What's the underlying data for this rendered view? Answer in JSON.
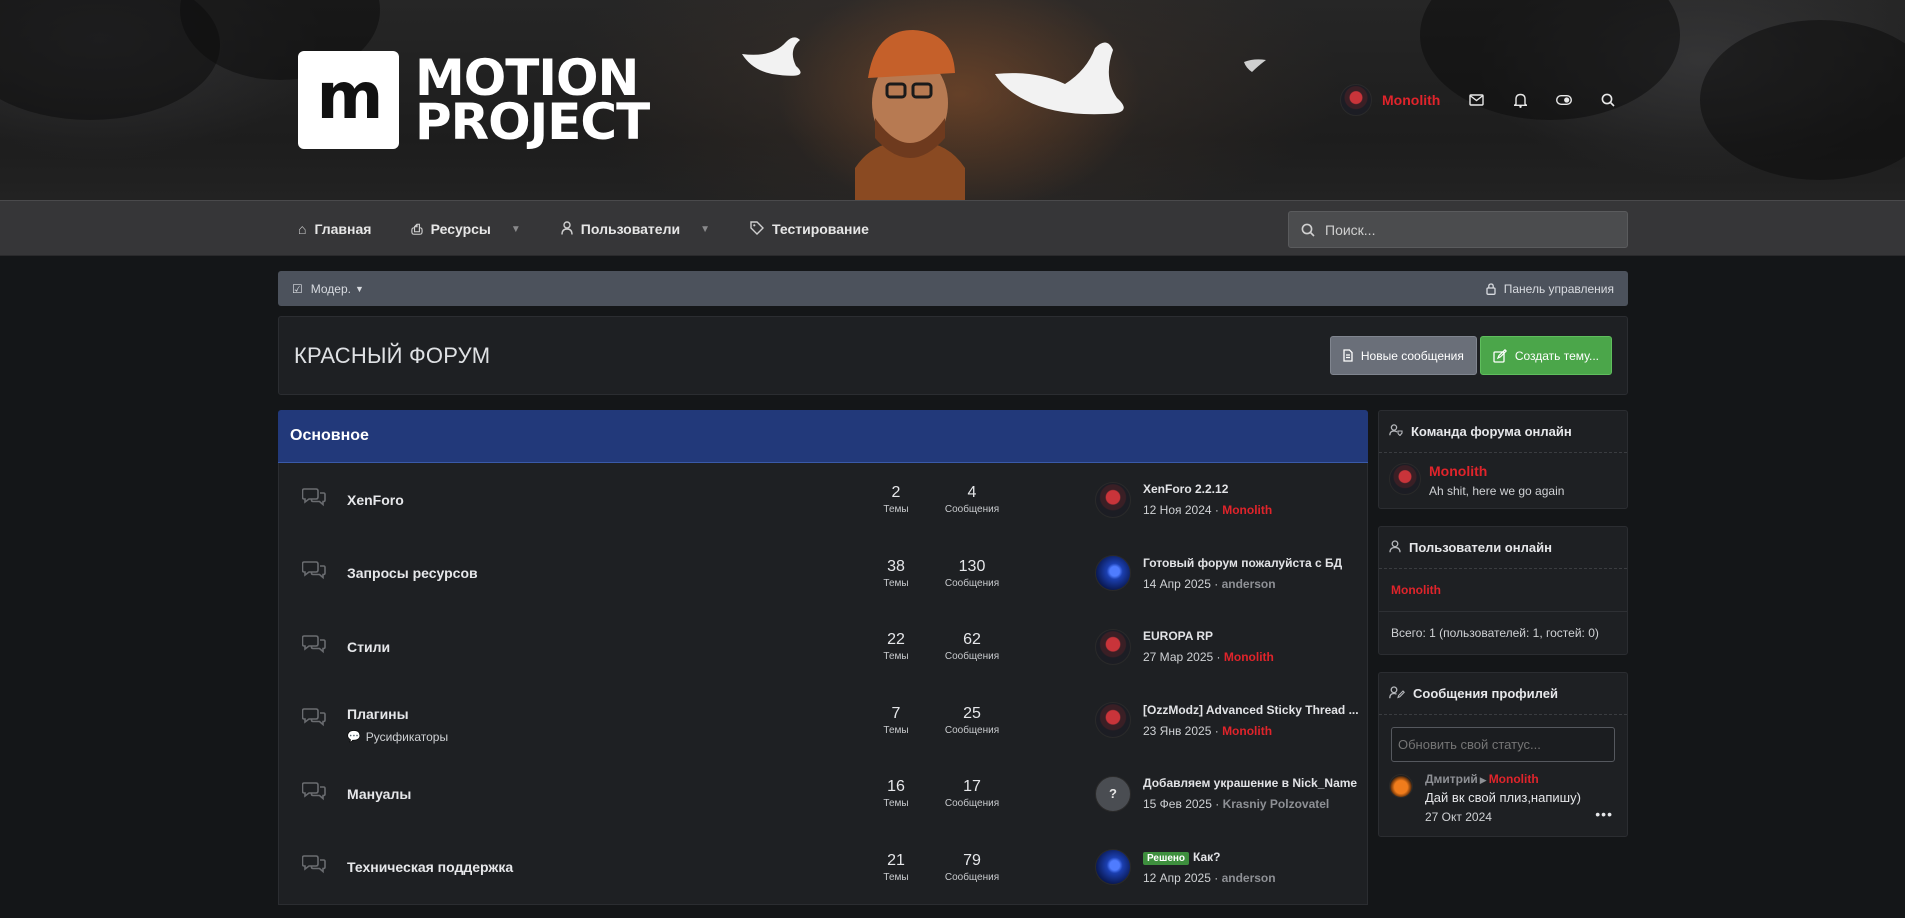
{
  "header": {
    "logo_mark": "m",
    "logo_line1": "MOTION",
    "logo_line2": "PROJECT",
    "user_name": "Monolith",
    "icons": [
      "mail-icon",
      "bell-icon",
      "toggle-icon",
      "search-icon"
    ]
  },
  "nav": {
    "items": [
      {
        "label": "Главная",
        "icon": "home-icon"
      },
      {
        "label": "Ресурсы",
        "icon": "box-icon"
      },
      {
        "label": "Пользователи",
        "icon": "user-icon"
      },
      {
        "label": "Тестирование",
        "icon": "tag-icon"
      }
    ],
    "search_placeholder": "Поиск..."
  },
  "modbar": {
    "moder_label": "Модер.",
    "panel_label": "Панель управления"
  },
  "page": {
    "title": "КРАСНЫЙ ФОРУМ",
    "btn_new_posts": "Новые сообщения",
    "btn_create_thread": "Создать тему..."
  },
  "category": {
    "title": "Основное",
    "stat_threads_label": "Темы",
    "stat_posts_label": "Сообщения",
    "forums": [
      {
        "title": "XenForo",
        "sub": "",
        "threads": "2",
        "posts": "4",
        "last_title": "XenForo 2.2.12",
        "last_date": "12 Ноя 2024",
        "last_user": "Monolith"
      },
      {
        "title": "Запросы ресурсов",
        "sub": "",
        "threads": "38",
        "posts": "130",
        "last_title": "Готовый форум пожалуйста с БД",
        "last_date": "14 Апр 2025",
        "last_user": "anderson"
      },
      {
        "title": "Стили",
        "sub": "",
        "threads": "22",
        "posts": "62",
        "last_title": "EUROPA RP",
        "last_date": "27 Мар 2025",
        "last_user": "Monolith"
      },
      {
        "title": "Плагины",
        "sub": "Русификаторы",
        "threads": "7",
        "posts": "25",
        "last_title": "[OzzModz] Advanced Sticky Thread ...",
        "last_date": "23 Янв 2025",
        "last_user": "Monolith"
      },
      {
        "title": "Мануалы",
        "sub": "",
        "threads": "16",
        "posts": "17",
        "last_title": "Добавляем украшение в Nick_Name",
        "last_date": "15 Фев 2025",
        "last_user": "Krasniy Polzovatel"
      },
      {
        "title": "Техническая поддержка",
        "sub": "",
        "threads": "21",
        "posts": "79",
        "last_badge": "Решено",
        "last_title": "Как?",
        "last_date": "12 Апр 2025",
        "last_user": "anderson"
      }
    ]
  },
  "sidebar": {
    "staff_title": "Команда форума онлайн",
    "staff_name": "Monolith",
    "staff_status": "Ah shit, here we go again",
    "online_title": "Пользователи онлайн",
    "online_user": "Monolith",
    "online_total": "Всего: 1 (пользователей: 1, гостей: 0)",
    "profile_title": "Сообщения профилей",
    "status_placeholder": "Обновить свой статус...",
    "post_from": "Дмитрий",
    "post_to": "Monolith",
    "post_msg": "Дай вк свой плиз,напишу)",
    "post_date": "27 Окт 2024"
  },
  "colors": {
    "accent_red": "#e0242b",
    "category_blue": "#22397a",
    "create_green": "#4ba64a"
  }
}
